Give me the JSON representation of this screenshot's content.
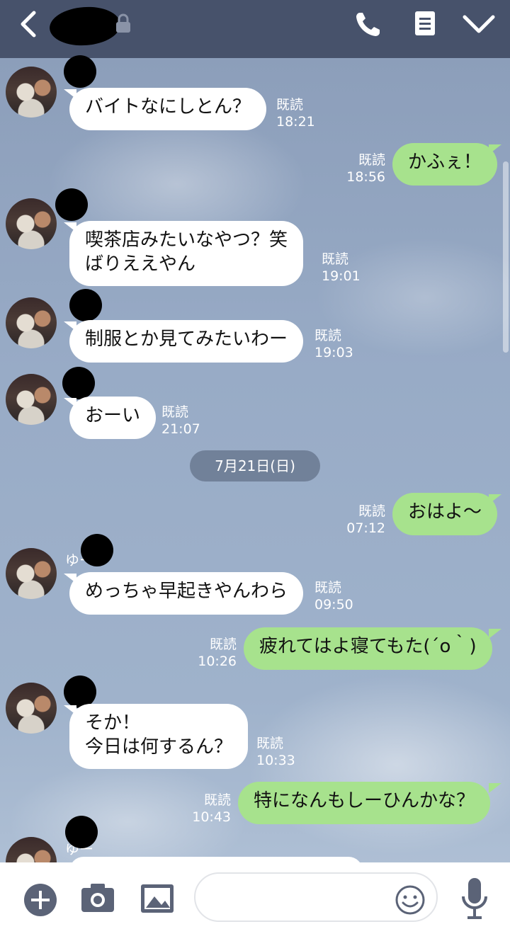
{
  "header": {
    "back_icon": "chevron-left-icon",
    "call_icon": "phone-icon",
    "notes_icon": "notes-icon",
    "menu_icon": "chevron-down-icon",
    "lock_icon": "lock-icon"
  },
  "date_separator": "7月21日(日)",
  "messages": [
    {
      "dir": "in",
      "text": "バイトなにしとん？",
      "read": "既読",
      "time": "18:21"
    },
    {
      "dir": "out",
      "text": "かふぇ！",
      "read": "既読",
      "time": "18:56"
    },
    {
      "dir": "in",
      "text": "喫茶店みたいなやつ？笑\nばりええやん",
      "read": "既読",
      "time": "19:01"
    },
    {
      "dir": "in",
      "text": "制服とか見てみたいわー",
      "read": "既読",
      "time": "19:03"
    },
    {
      "dir": "in",
      "text": "おーい",
      "read": "既読",
      "time": "21:07"
    },
    {
      "dir": "out",
      "text": "おはよ～",
      "read": "既読",
      "time": "07:12"
    },
    {
      "dir": "in",
      "sender": "ゆー",
      "text": "めっちゃ早起きやんわら",
      "read": "既読",
      "time": "09:50"
    },
    {
      "dir": "out",
      "text": "疲れてはよ寝てもた(´o｀)",
      "read": "既読",
      "time": "10:26"
    },
    {
      "dir": "in",
      "text": "そか！\n今日は何するん？",
      "read": "既読",
      "time": "10:33"
    },
    {
      "dir": "out",
      "text": "特になんもしーひんかな？",
      "read": "既読",
      "time": "10:43"
    },
    {
      "dir": "in",
      "sender": "ゆー",
      "text": "",
      "read": "",
      "time": ""
    }
  ],
  "footer": {
    "add_icon": "plus-circle-icon",
    "camera_icon": "camera-icon",
    "image_icon": "image-icon",
    "input_placeholder": "",
    "emoji_icon": "emoji-icon",
    "mic_icon": "microphone-icon"
  },
  "colors": {
    "header_bg": "#47526b",
    "bubble_in": "#ffffff",
    "bubble_out": "#a7e28d",
    "footer_icon": "#5b6377"
  }
}
